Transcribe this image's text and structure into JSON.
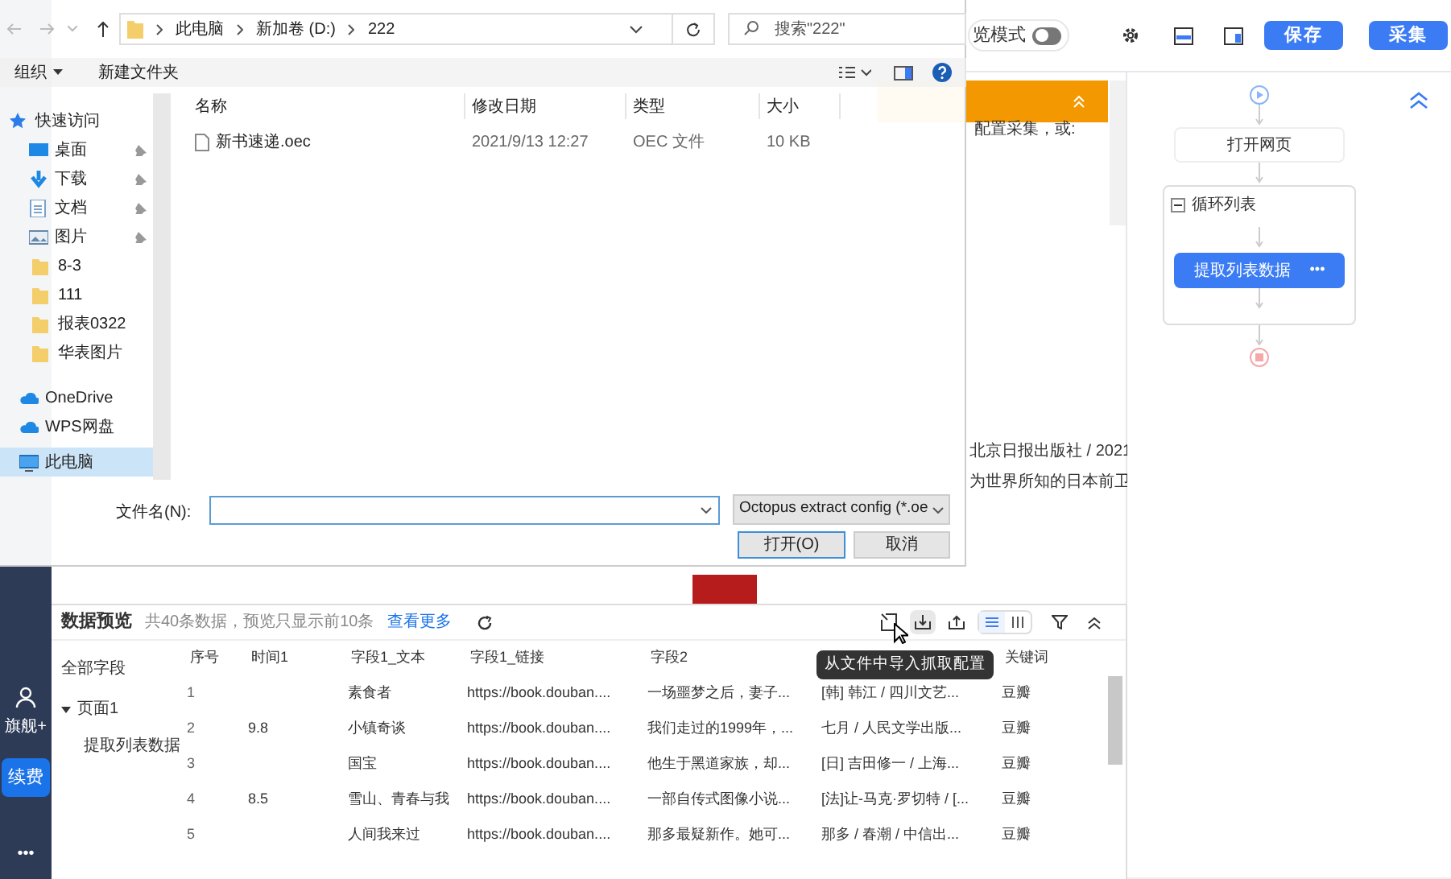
{
  "toolbar": {
    "mode_label": "览模式",
    "mode_on": false,
    "buttons": [
      "保存",
      "采集"
    ]
  },
  "sidebar": {
    "account": "旗舰+",
    "renew": "续费",
    "more": "•••"
  },
  "browser": {
    "texts": [
      "配置采集，或:",
      "北京日报出版社 / 2021",
      "为世界所知的日本前卫"
    ]
  },
  "dialog": {
    "path": [
      "此电脑",
      "新加卷 (D:)",
      "222"
    ],
    "search_placeholder": "搜索\"222\"",
    "actions": [
      "组织",
      "新建文件夹"
    ],
    "nav": [
      {
        "label": "快速访问",
        "kind": "star",
        "pinned": false,
        "selected": false
      },
      {
        "label": "桌面",
        "kind": "desktop",
        "pinned": true,
        "selected": false
      },
      {
        "label": "下载",
        "kind": "download",
        "pinned": true,
        "selected": false
      },
      {
        "label": "文档",
        "kind": "document",
        "pinned": true,
        "selected": false
      },
      {
        "label": "图片",
        "kind": "picture",
        "pinned": true,
        "selected": false
      },
      {
        "label": "8-3",
        "kind": "folder",
        "pinned": false,
        "selected": false
      },
      {
        "label": "111",
        "kind": "folder",
        "pinned": false,
        "selected": false
      },
      {
        "label": "报表0322",
        "kind": "folder",
        "pinned": false,
        "selected": false
      },
      {
        "label": "华表图片",
        "kind": "folder",
        "pinned": false,
        "selected": false
      },
      {
        "label": "OneDrive",
        "kind": "cloud",
        "pinned": false,
        "selected": false
      },
      {
        "label": "WPS网盘",
        "kind": "cloud",
        "pinned": false,
        "selected": false
      },
      {
        "label": "此电脑",
        "kind": "pc",
        "pinned": false,
        "selected": true
      }
    ],
    "columns": [
      "名称",
      "修改日期",
      "类型",
      "大小"
    ],
    "files": [
      {
        "name": "新书速递.oec",
        "date": "2021/9/13 12:27",
        "type": "OEC 文件",
        "size": "10 KB",
        "selected": false
      }
    ],
    "filename_label": "文件名(N):",
    "filetype": "Octopus extract config (*.oe",
    "buttons": [
      "打开(O)",
      "取消"
    ]
  },
  "flow": {
    "open_page": "打开网页",
    "loop": {
      "label": "循环列表",
      "expanded": true,
      "action": "提取列表数据",
      "action_menu": "•••"
    }
  },
  "preview": {
    "title": "数据预览",
    "info": "共40条数据，预览只显示前10条",
    "more_link": "查看更多",
    "view_buttons": [
      {
        "kind": "list",
        "selected": true
      },
      {
        "kind": "columns",
        "selected": false
      }
    ],
    "fields": {
      "label": "全部字段",
      "children": [
        {
          "label": "页面1",
          "expanded": true,
          "children": [
            {
              "label": "提取列表数据"
            }
          ]
        }
      ]
    },
    "columns": [
      {
        "label": "序号"
      },
      {
        "label": "时间1"
      },
      {
        "label": "字段1_文本"
      },
      {
        "label": "字段1_链接"
      },
      {
        "label": "字段2"
      },
      {},
      {
        "label": "关键词"
      }
    ],
    "rows": [
      [
        "1",
        null,
        "素食者",
        "https://book.douban....",
        "一场噩梦之后，妻子...",
        "[韩] 韩江 / 四川文艺...",
        "豆瓣"
      ],
      [
        "2",
        "9.8",
        "小镇奇谈",
        "https://book.douban....",
        "我们走过的1999年，...",
        "七月 / 人民文学出版...",
        "豆瓣"
      ],
      [
        "3",
        null,
        "国宝",
        "https://book.douban....",
        "他生于黑道家族，却...",
        "[日] 吉田修一 / 上海...",
        "豆瓣"
      ],
      [
        "4",
        "8.5",
        "雪山、青春与我",
        "https://book.douban....",
        "一部自传式图像小说...",
        "[法]让-马克·罗切特 / [...",
        "豆瓣"
      ],
      [
        "5",
        null,
        "人间我来过",
        "https://book.douban....",
        "那多最疑新作。她可...",
        "那多 / 春潮 / 中信出...",
        "豆瓣"
      ]
    ]
  },
  "tooltip": "从文件中导入抓取配置"
}
